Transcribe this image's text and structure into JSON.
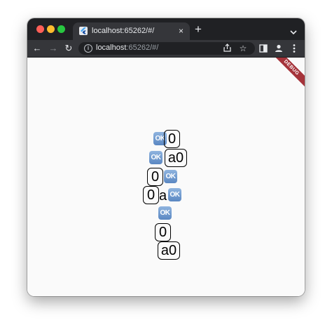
{
  "browser": {
    "tab": {
      "title": "localhost:65262/#/",
      "close_label": "×"
    },
    "new_tab_label": "+",
    "address": {
      "host": "localhost",
      "rest": ":65262/#/"
    },
    "nav": {
      "back": "←",
      "forward": "→",
      "reload": "↻"
    }
  },
  "app": {
    "debug_banner": "DEBUG",
    "rows": [
      {
        "emoji": "OK",
        "text": "0"
      },
      {
        "emoji": "OK",
        "text": "a0"
      },
      {
        "text": "0",
        "emoji": "OK"
      },
      {
        "text": "0",
        "overlap": "a",
        "emoji": "OK"
      },
      {
        "emoji": "OK"
      },
      {
        "text": "0"
      },
      {
        "text": "a0"
      }
    ]
  }
}
